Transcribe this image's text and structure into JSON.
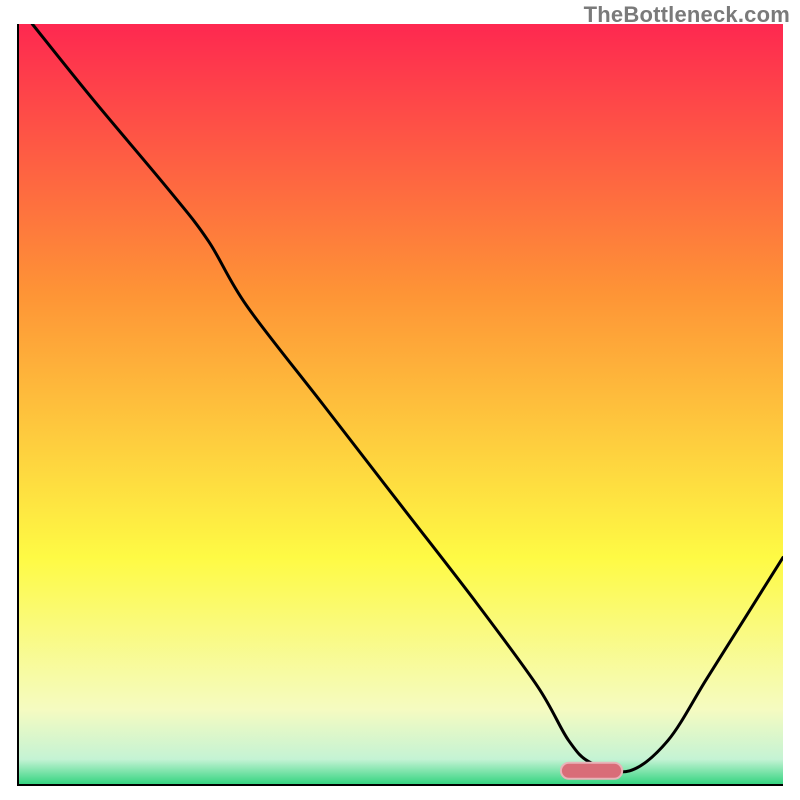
{
  "watermark": "TheBottleneck.com",
  "colors": {
    "gradient_top": "#fe2850",
    "gradient_mid1": "#fe9336",
    "gradient_mid2": "#fefa44",
    "gradient_mid3": "#f5fbc1",
    "gradient_bottom": "#2ad27a",
    "axis": "#000000",
    "curve": "#000000",
    "marker_fill": "#d96d78",
    "marker_stroke": "#e8b4b9"
  },
  "chart_data": {
    "type": "line",
    "title": "",
    "xlabel": "",
    "ylabel": "",
    "xlim": [
      0,
      100
    ],
    "ylim": [
      0,
      100
    ],
    "x": [
      2,
      10,
      20,
      25,
      30,
      40,
      50,
      60,
      68,
      72,
      75,
      80,
      85,
      90,
      95,
      100
    ],
    "values": [
      100,
      90,
      78,
      71.5,
      63,
      50,
      37,
      24,
      13,
      6,
      3,
      2,
      6,
      14,
      22,
      30
    ],
    "marker": {
      "x_start": 71,
      "x_end": 79,
      "y": 2
    }
  }
}
